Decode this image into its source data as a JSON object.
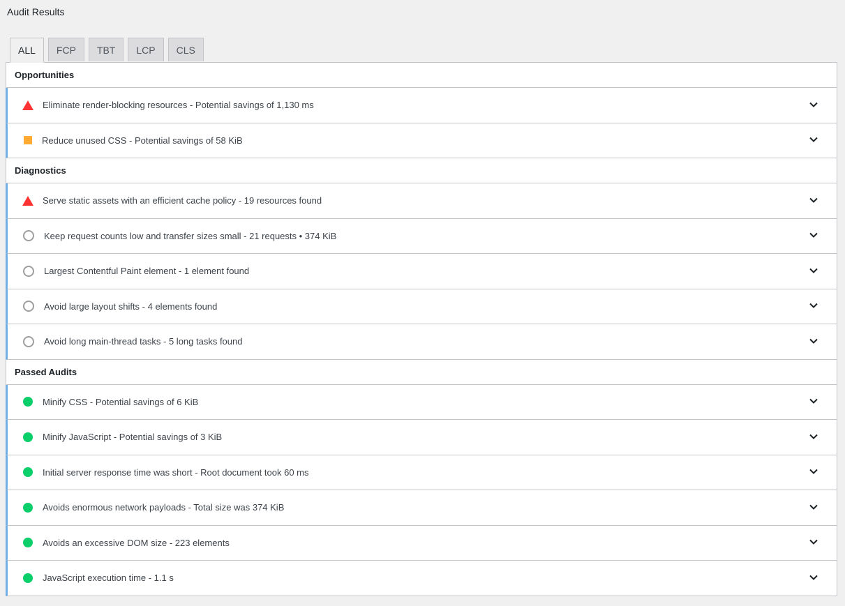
{
  "page_title": "Audit Results",
  "tabs": [
    {
      "label": "ALL",
      "active": true
    },
    {
      "label": "FCP",
      "active": false
    },
    {
      "label": "TBT",
      "active": false
    },
    {
      "label": "LCP",
      "active": false
    },
    {
      "label": "CLS",
      "active": false
    }
  ],
  "colors": {
    "fail": "#ff3333",
    "average": "#ffaa33",
    "pass": "#0cce6b",
    "info": "#9e9e9e",
    "row_accent": "#72aee6"
  },
  "sections": {
    "opportunities": {
      "title": "Opportunities",
      "items": [
        {
          "status": "fail",
          "icon": "red-triangle-icon",
          "text": "Eliminate render-blocking resources - Potential savings of 1,130 ms"
        },
        {
          "status": "average",
          "icon": "orange-square-icon",
          "text": "Reduce unused CSS - Potential savings of 58 KiB"
        }
      ]
    },
    "diagnostics": {
      "title": "Diagnostics",
      "items": [
        {
          "status": "fail",
          "icon": "red-triangle-icon",
          "text": "Serve static assets with an efficient cache policy - 19 resources found"
        },
        {
          "status": "info",
          "icon": "gray-circle-icon",
          "text": "Keep request counts low and transfer sizes small - 21 requests • 374 KiB"
        },
        {
          "status": "info",
          "icon": "gray-circle-icon",
          "text": "Largest Contentful Paint element - 1 element found"
        },
        {
          "status": "info",
          "icon": "gray-circle-icon",
          "text": "Avoid large layout shifts - 4 elements found"
        },
        {
          "status": "info",
          "icon": "gray-circle-icon",
          "text": "Avoid long main-thread tasks - 5 long tasks found"
        }
      ]
    },
    "passed": {
      "title": "Passed Audits",
      "items": [
        {
          "status": "pass",
          "icon": "green-circle-icon",
          "text": "Minify CSS - Potential savings of 6 KiB"
        },
        {
          "status": "pass",
          "icon": "green-circle-icon",
          "text": "Minify JavaScript - Potential savings of 3 KiB"
        },
        {
          "status": "pass",
          "icon": "green-circle-icon",
          "text": "Initial server response time was short - Root document took 60 ms"
        },
        {
          "status": "pass",
          "icon": "green-circle-icon",
          "text": "Avoids enormous network payloads - Total size was 374 KiB"
        },
        {
          "status": "pass",
          "icon": "green-circle-icon",
          "text": "Avoids an excessive DOM size - 223 elements"
        },
        {
          "status": "pass",
          "icon": "green-circle-icon",
          "text": "JavaScript execution time - 1.1 s"
        }
      ]
    }
  }
}
